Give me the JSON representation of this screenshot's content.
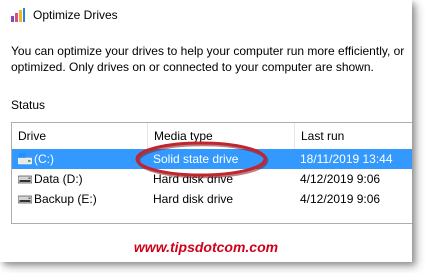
{
  "window": {
    "title": "Optimize Drives",
    "app_icon": "optimize-drives-app-icon"
  },
  "description": {
    "line1": "You can optimize your drives to help your computer run more efficiently, or",
    "line2": "optimized. Only drives on or connected to your computer are shown."
  },
  "status": {
    "label": "Status",
    "columns": [
      "Drive",
      "Media type",
      "Last run"
    ],
    "rows": [
      {
        "drive": "(C:)",
        "media_type": "Solid state drive",
        "last_run": "18/11/2019 13:44",
        "icon": "windows-drive-icon",
        "selected": true
      },
      {
        "drive": "Data (D:)",
        "media_type": "Hard disk drive",
        "last_run": "4/12/2019 9:06",
        "icon": "hard-disk-icon",
        "selected": false
      },
      {
        "drive": "Backup (E:)",
        "media_type": "Hard disk drive",
        "last_run": "4/12/2019 9:06",
        "icon": "hard-disk-icon",
        "selected": false
      }
    ]
  },
  "colors": {
    "selection": "#3399ff",
    "annotation": "#c0262d",
    "watermark": "#d0021b"
  },
  "watermark": "www.tipsdotcom.com"
}
